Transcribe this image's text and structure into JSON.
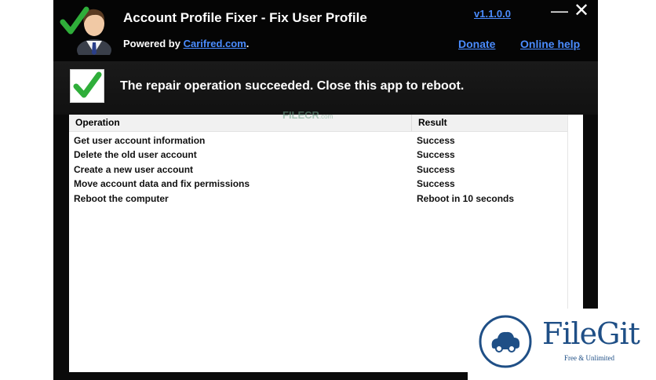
{
  "window": {
    "title": "Account Profile Fixer - Fix User Profile",
    "powered_by_prefix": "Powered by ",
    "powered_by_link": "Carifred.com",
    "powered_by_suffix": ".",
    "version": "v1.1.0.0",
    "donate": "Donate",
    "online_help": "Online help",
    "minimize_glyph": "—",
    "close_glyph": "✕"
  },
  "icons": {
    "app": "user-checkmark-icon",
    "status": "green-checkmark-icon",
    "brand": "cloud-icon"
  },
  "status": {
    "message": "The repair operation succeeded. Close this app to reboot."
  },
  "table": {
    "columns": [
      "Operation",
      "Result"
    ],
    "rows": [
      {
        "operation": "Get user account information",
        "result": "Success"
      },
      {
        "operation": "Delete the old user account",
        "result": "Success"
      },
      {
        "operation": "Create a new user account",
        "result": "Success"
      },
      {
        "operation": "Move account data and fix permissions",
        "result": "Success"
      },
      {
        "operation": "Reboot the computer",
        "result": "Reboot in 10 seconds"
      }
    ]
  },
  "watermarks": {
    "filecr_main": "FILECR",
    "filecr_sub": ".com",
    "filegit_name": "FileGit",
    "filegit_tagline": "Free & Unlimited"
  },
  "colors": {
    "background": "#0a0a0a",
    "link": "#4a8cff",
    "check_green": "#2fae3a",
    "filegit_blue": "#1f4f86"
  }
}
